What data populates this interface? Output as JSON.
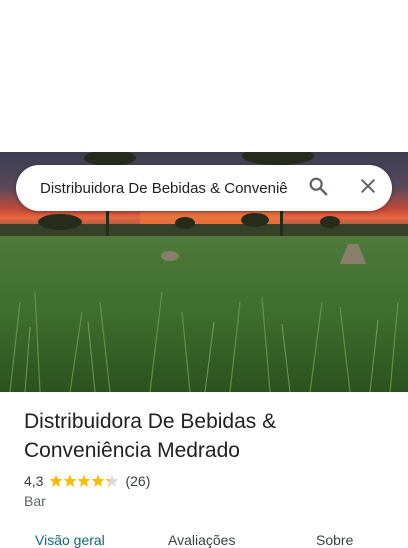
{
  "search": {
    "query": "Distribuidora De Bebidas & Conveniência Medrado"
  },
  "icons": {
    "search": "search-icon",
    "close": "close-icon",
    "star": "star-icon"
  },
  "place": {
    "name_line1": "Distribuidora De Bebidas &",
    "name_line2": "Conveniência Medrado",
    "rating": "4,3",
    "rating_value": 4.3,
    "stars_out_of": 5,
    "review_count": "(26)",
    "category": "Bar"
  },
  "tabs": [
    {
      "label": "Visão geral",
      "active": true
    },
    {
      "label": "Avaliações",
      "active": false
    },
    {
      "label": "Sobre",
      "active": false
    }
  ],
  "colors": {
    "accent": "#0b6b78",
    "star": "#fbbc04",
    "text": "#202124"
  }
}
